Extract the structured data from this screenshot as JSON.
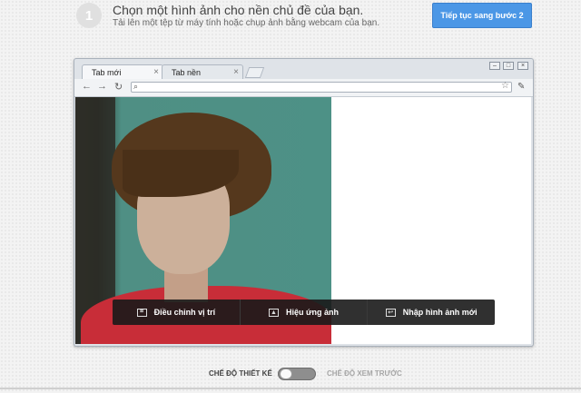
{
  "step": {
    "number": "1",
    "title": "Chọn một hình ảnh cho nền chủ đề của bạn.",
    "subtitle": "Tải lên một tệp từ máy tính hoặc chụp ảnh bằng webcam của bạn.",
    "continue_label": "Tiếp tục sang bước 2"
  },
  "browser": {
    "tabs": [
      {
        "label": "Tab mới",
        "icon": "close-icon"
      },
      {
        "label": "Tab nền",
        "icon": "close-icon"
      }
    ],
    "window_controls": [
      "minimize-icon",
      "maximize-icon",
      "close-icon"
    ],
    "toolbar_icons": [
      "back-arrow-icon",
      "forward-arrow-icon",
      "reload-icon",
      "search-icon",
      "star-icon",
      "wrench-icon"
    ]
  },
  "photo_toolbar": {
    "items": [
      {
        "label": "Điều chỉnh vị trí",
        "icon": "crop-icon"
      },
      {
        "label": "Hiệu ứng ảnh",
        "icon": "image-icon"
      },
      {
        "label": "Nhập hình ảnh mới",
        "icon": "import-icon"
      }
    ]
  },
  "mode": {
    "design_label": "CHẾ ĐỘ THIẾT KẾ",
    "preview_label": "CHẾ ĐỘ XEM TRƯỚC",
    "toggle_state": "off"
  },
  "colors": {
    "accent_button": "#4b97e6",
    "photo_bg": "#4d9186",
    "shirt": "#c82d38",
    "toolbar_bg": "#1a1a1a"
  }
}
